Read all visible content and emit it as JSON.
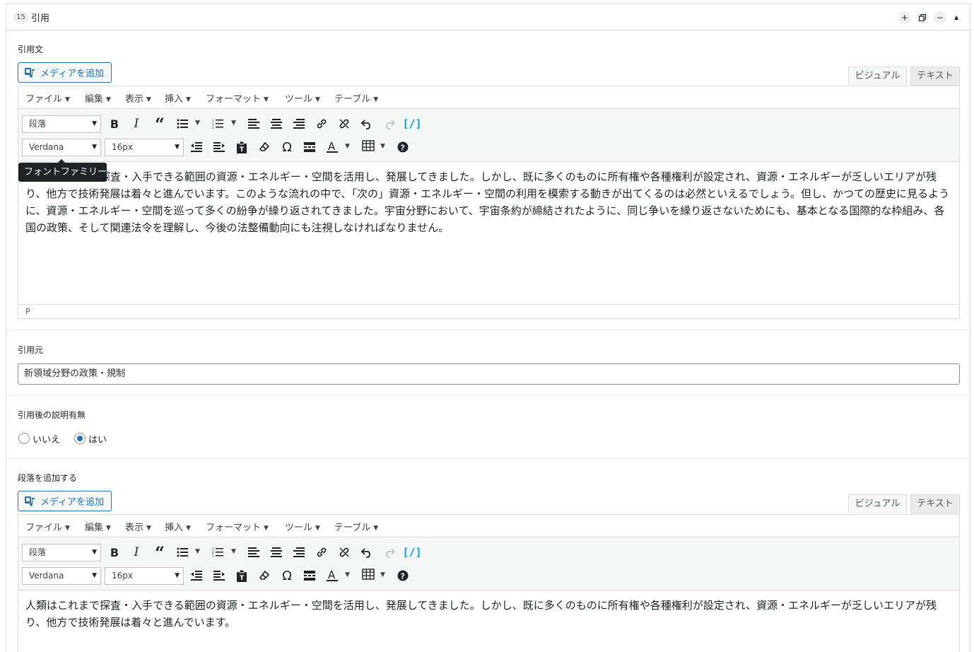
{
  "block": {
    "number": "15",
    "title": "引用",
    "add_icon": "plus-icon",
    "duplicate_icon": "duplicate-icon",
    "remove_icon": "minus-icon",
    "collapse_icon": "caret-up-icon"
  },
  "quote_field": {
    "label": "引用文",
    "media_button": "メディアを追加",
    "tabs": [
      "ビジュアル",
      "テキスト"
    ],
    "menu": [
      "ファイル",
      "編集",
      "表示",
      "挿入",
      "フォーマット",
      "ツール",
      "テーブル"
    ],
    "format_select": "段落",
    "font_select": "Verdana",
    "size_select": "16px",
    "tooltip": "フォントファミリー",
    "content": "人類はこれまで探査・入手できる範囲の資源・エネルギー・空間を活用し、発展してきました。しかし、既に多くのものに所有権や各種権利が設定され、資源・エネルギーが乏しいエリアが残り、他方で技術発展は着々と進んでいます。このような流れの中で、「次の」資源・エネルギー・空間の利用を模索する動きが出てくるのは必然といえるでしょう。但し、かつての歴史に見るように、資源・エネルギー・空間を巡って多くの紛争が繰り返されてきました。宇宙分野において、宇宙条約が締結されたように、同じ争いを繰り返さないためにも、基本となる国際的な枠組み、各国の政策、そして関連法令を理解し、今後の法整備動向にも注視しなければなりません。",
    "status_path": "P"
  },
  "source_field": {
    "label": "引用元",
    "value": "新領域分野の政策・規制"
  },
  "explanation_field": {
    "label": "引用後の説明有無",
    "options": [
      "いいえ",
      "はい"
    ],
    "selected": "はい"
  },
  "paragraph_field": {
    "label": "段落を追加する",
    "media_button": "メディアを追加",
    "tabs": [
      "ビジュアル",
      "テキスト"
    ],
    "menu": [
      "ファイル",
      "編集",
      "表示",
      "挿入",
      "フォーマット",
      "ツール",
      "テーブル"
    ],
    "format_select": "段落",
    "font_select": "Verdana",
    "size_select": "16px",
    "content": "人類はこれまで探査・入手できる範囲の資源・エネルギー・空間を活用し、発展してきました。しかし、既に多くのものに所有権や各種権利が設定され、資源・エネルギーが乏しいエリアが残り、他方で技術発展は着々と進んでいます。"
  },
  "colors": {
    "accent": "#2271b1",
    "code_icon": "#00a0d2",
    "border": "#dcdcde",
    "toolbar_bg": "#f6f7f7"
  }
}
